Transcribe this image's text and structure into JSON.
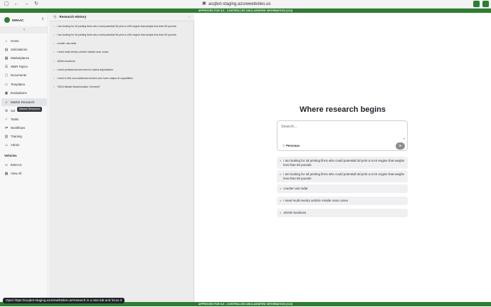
{
  "browser": {
    "url": "acqbot-staging.azurewebsites.us",
    "url_icon": "site-icon",
    "extension_colors": [
      "#2e7d32",
      "#2e7d32"
    ]
  },
  "banners": {
    "top": "APPROVED FOR IL5 - CONTROLLED UNCLASSIFIED INFORMATION (CUI)",
    "bottom": "APPROVED FOR IL5 - CONTROLLED UNCLASSIFIED INFORMATION (CUI)"
  },
  "sidebar": {
    "org_name": "EWAAC",
    "items": [
      {
        "label": "Home",
        "icon": "home-icon",
        "glyph": "⌂"
      },
      {
        "label": "Solicitations",
        "icon": "document-icon",
        "glyph": "▤"
      },
      {
        "label": "Marketplaces",
        "icon": "grid-icon",
        "glyph": "▦"
      },
      {
        "label": "SBIR Topics",
        "icon": "list-icon",
        "glyph": "☰"
      },
      {
        "label": "Documents",
        "icon": "file-icon",
        "glyph": "▢"
      },
      {
        "label": "Templates",
        "icon": "template-icon",
        "glyph": "▭"
      },
      {
        "label": "Evaluations",
        "icon": "clipboard-icon",
        "glyph": "▣"
      },
      {
        "label": "Market Research",
        "icon": "search-icon",
        "glyph": "⌕"
      },
      {
        "label": "Sol",
        "icon": "settings-icon",
        "glyph": "⚙"
      },
      {
        "label": "Tasks",
        "icon": "tasks-icon",
        "glyph": "✓"
      },
      {
        "label": "Workflows",
        "icon": "workflow-icon",
        "glyph": "⇄"
      },
      {
        "label": "Training",
        "icon": "book-icon",
        "glyph": "▥"
      },
      {
        "label": "Admin",
        "icon": "user-icon",
        "glyph": "☺"
      }
    ],
    "vehicles_label": "Vehicles",
    "vehicles": [
      {
        "label": "EWAAC",
        "icon": "link-icon",
        "glyph": "∞"
      },
      {
        "label": "View All",
        "icon": "grid-icon",
        "glyph": "▦"
      }
    ],
    "tooltip": "Market Research"
  },
  "history": {
    "title": "Research History",
    "items": [
      "I am looking for 3d printing firms who could potentiall 3d print a UAS engine that weighs less than 50 pounds",
      "I am looking for 3d printing firms who could potentiall 3d print a UAS engine that weighs less than 50 pounds",
      "counter uas radar",
      "I need multi reentry vehicle missile nose cones",
      "JDAM munitions",
      "I need professional services for claims adjudication",
      "I need to find non-traditional vendors who have unique AI capabilities",
      "\"SM-6 Missile Modernization Overview\""
    ]
  },
  "main": {
    "headline": "Where research begins",
    "search_placeholder": "Search...",
    "personas_label": "Personas",
    "suggestions": [
      "I am looking for 3d printing firms who could potentiall 3d print a UAS engine that weighs less than 50 pounds",
      "I am looking for 3d printing firms who could potentiall 3d print a UAS engine that weighs less than 50 pounds",
      "counter uas radar",
      "I need multi reentry vehicle missile nose cones",
      "JDAM munitions"
    ]
  },
  "status_text": "Open https://acqbot-staging.azurewebsites.us/research in a new tab and focus it"
}
